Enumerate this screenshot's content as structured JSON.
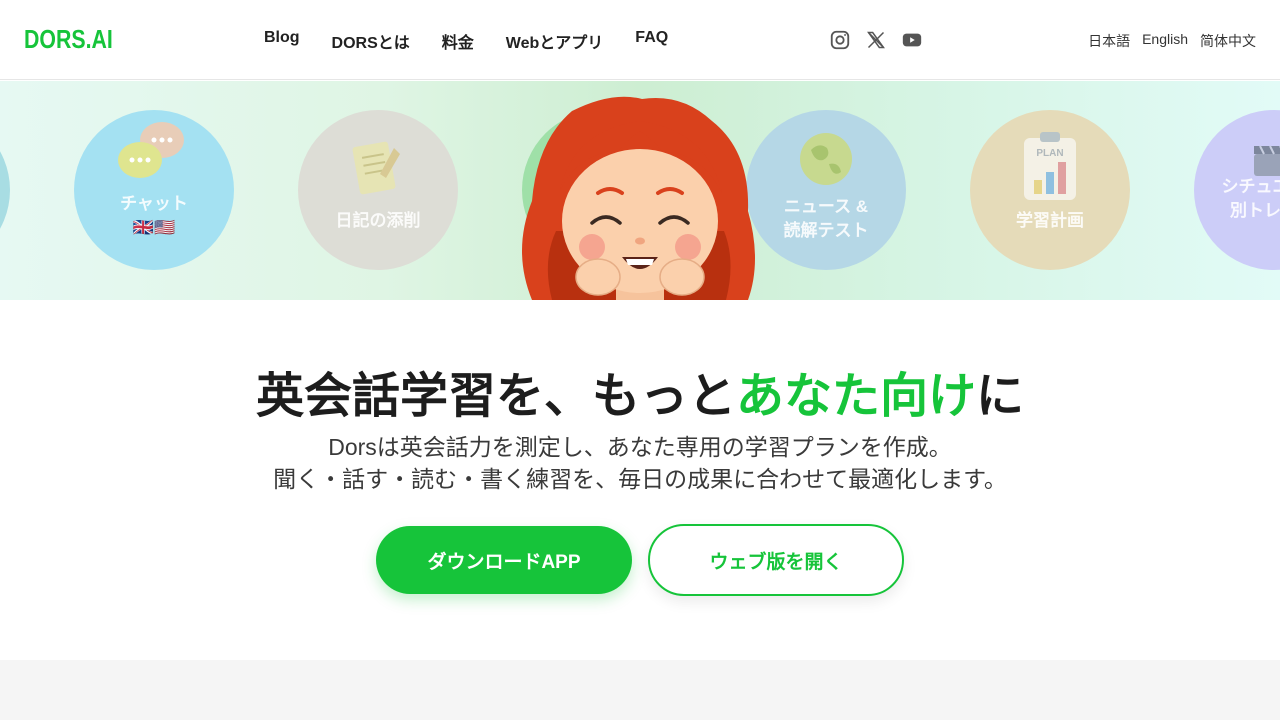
{
  "header": {
    "logo": "DORS.AI",
    "nav": [
      "Blog",
      "DORSとは",
      "料金",
      "Webとアプリ",
      "FAQ"
    ],
    "social": [
      "instagram-icon",
      "x-icon",
      "youtube-icon"
    ],
    "languages": [
      "日本語",
      "English",
      "简体中文"
    ]
  },
  "features": [
    {
      "label": "",
      "color": "#a8dde3"
    },
    {
      "label": "チャット\n🇬🇧🇺🇸",
      "color": "#a4e1f2"
    },
    {
      "label": "日記の添削",
      "color": "#ddddd6"
    },
    {
      "label": "",
      "color": "#9fe0a8"
    },
    {
      "label": "ニュース &\n読解テスト",
      "color": "#b5d7e6"
    },
    {
      "label": "学習計画",
      "color": "#e5dbb9"
    },
    {
      "label": "シチュエー\n別トレー",
      "color": "#cccdf8"
    }
  ],
  "hero": {
    "headline_main": "英会話学習を、もっと",
    "headline_accent": "あなた向け",
    "headline_end": "に",
    "subtitle_line1": "Dorsは英会話力を測定し、あなた専用の学習プランを作成。",
    "subtitle_line2": "聞く・話す・読む・書く練習を、毎日の成果に合わせて最適化します。",
    "primary_button": "ダウンロードAPP",
    "secondary_button": "ウェブ版を開く"
  },
  "colors": {
    "brand": "#16c43a",
    "text": "#1d1d1d",
    "footer_bg": "#f5f5f5"
  }
}
